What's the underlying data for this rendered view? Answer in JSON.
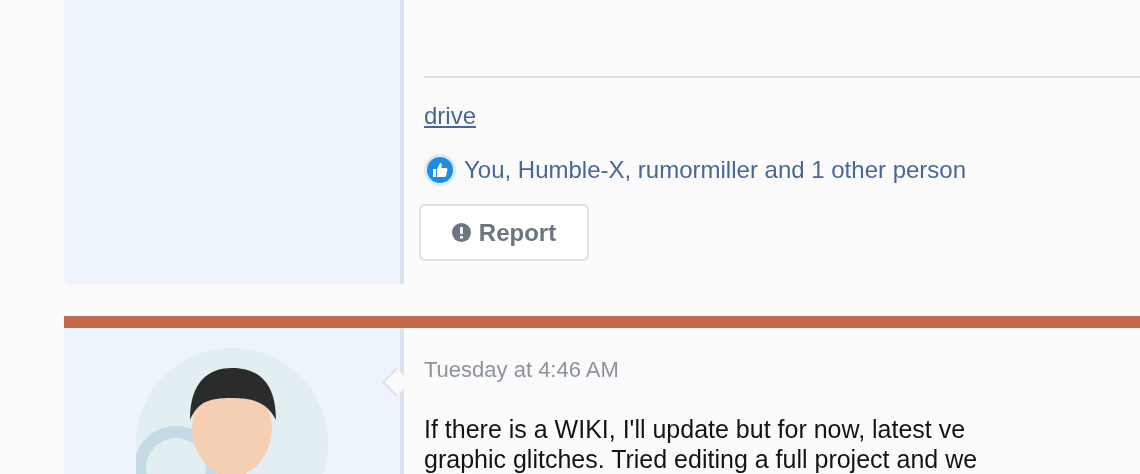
{
  "first_post": {
    "link": "drive",
    "reactions": {
      "text": "You, Humble-X, rumormiller and 1 other person"
    },
    "report_button": "Report"
  },
  "second_post": {
    "date": "Tuesday at 4:46 AM",
    "body_lines": [
      "If there is a WIKI, I'll update but for now, latest ve",
      "graphic glitches. Tried editing a full project and we"
    ]
  }
}
